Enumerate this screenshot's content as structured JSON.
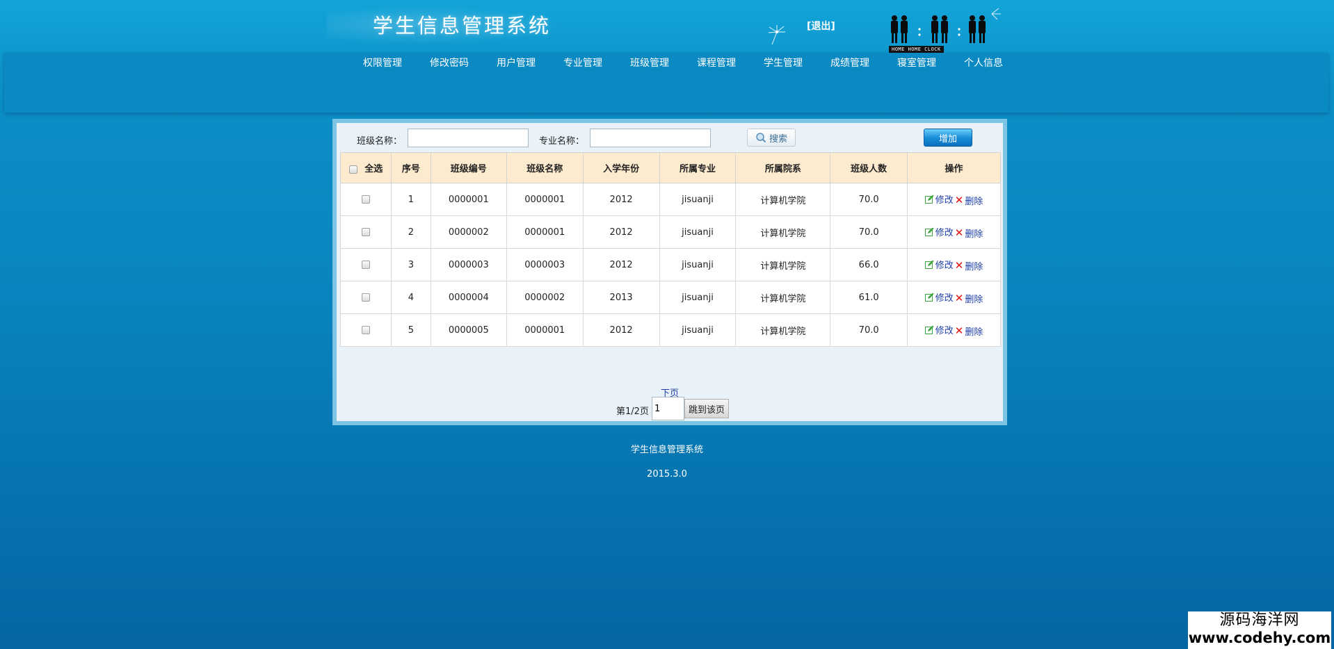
{
  "header": {
    "title": "学生信息管理系统",
    "logout_label": "[退出]",
    "clock_label": "HOME HOME CLOCK"
  },
  "nav": {
    "items": [
      {
        "label": "权限管理"
      },
      {
        "label": "修改密码"
      },
      {
        "label": "用户管理"
      },
      {
        "label": "专业管理"
      },
      {
        "label": "班级管理"
      },
      {
        "label": "课程管理"
      },
      {
        "label": "学生管理"
      },
      {
        "label": "成绩管理"
      },
      {
        "label": "寝室管理"
      },
      {
        "label": "个人信息"
      }
    ]
  },
  "search": {
    "class_name_label": "班级名称：",
    "class_name_value": "",
    "major_name_label": "专业名称：",
    "major_name_value": "",
    "search_label": "搜索",
    "add_label": "增加"
  },
  "table": {
    "headers": {
      "select_all": "全选",
      "index": "序号",
      "class_code": "班级编号",
      "class_name": "班级名称",
      "enroll_year": "入学年份",
      "major": "所属专业",
      "department": "所属院系",
      "count": "班级人数",
      "actions": "操作"
    },
    "edit_label": "修改",
    "delete_label": "删除",
    "rows": [
      {
        "index": "1",
        "class_code": "0000001",
        "class_name": "0000001",
        "enroll_year": "2012",
        "major": "jisuanji",
        "department": "计算机学院",
        "count": "70.0"
      },
      {
        "index": "2",
        "class_code": "0000002",
        "class_name": "0000001",
        "enroll_year": "2012",
        "major": "jisuanji",
        "department": "计算机学院",
        "count": "70.0"
      },
      {
        "index": "3",
        "class_code": "0000003",
        "class_name": "0000003",
        "enroll_year": "2012",
        "major": "jisuanji",
        "department": "计算机学院",
        "count": "66.0"
      },
      {
        "index": "4",
        "class_code": "0000004",
        "class_name": "0000002",
        "enroll_year": "2013",
        "major": "jisuanji",
        "department": "计算机学院",
        "count": "61.0"
      },
      {
        "index": "5",
        "class_code": "0000005",
        "class_name": "0000001",
        "enroll_year": "2012",
        "major": "jisuanji",
        "department": "计算机学院",
        "count": "70.0"
      }
    ]
  },
  "pager": {
    "next_label": "下页",
    "page_info": "第1/2页",
    "page_input_value": "1",
    "jump_label": "跳到该页"
  },
  "footer": {
    "line1": "学生信息管理系统",
    "line2": "2015.3.0"
  },
  "watermark": {
    "line1": "源码海洋网",
    "line2": "www.codehy.com"
  },
  "colors": {
    "nav_bg": "#0a89c2",
    "table_header_bg": "#fdebcf",
    "link": "#1d3ea8",
    "delete": "#e01010"
  }
}
